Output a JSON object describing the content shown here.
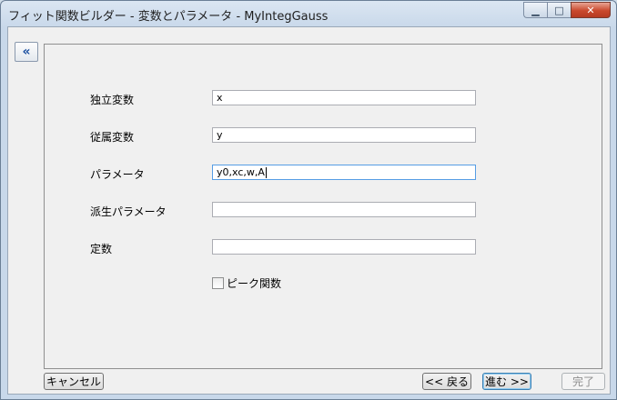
{
  "window": {
    "title": "フィット関数ビルダー - 変数とパラメータ - MyIntegGauss",
    "minimize_glyph": "▁",
    "maximize_glyph": "□",
    "close_glyph": "✕"
  },
  "collapse_button": {
    "icon": "double-chevron-left",
    "glyph": "«"
  },
  "fields": {
    "independent": {
      "label": "独立変数",
      "value": "x"
    },
    "dependent": {
      "label": "従属変数",
      "value": "y"
    },
    "parameters": {
      "label": "パラメータ",
      "value": "y0,xc,w,A"
    },
    "derived": {
      "label": "派生パラメータ",
      "value": ""
    },
    "constants": {
      "label": "定数",
      "value": ""
    }
  },
  "peak_function": {
    "label": "ピーク関数",
    "checked": false
  },
  "buttons": {
    "cancel": "キャンセル",
    "back": "<< 戻る",
    "next": "進む >>",
    "finish": "完了"
  }
}
